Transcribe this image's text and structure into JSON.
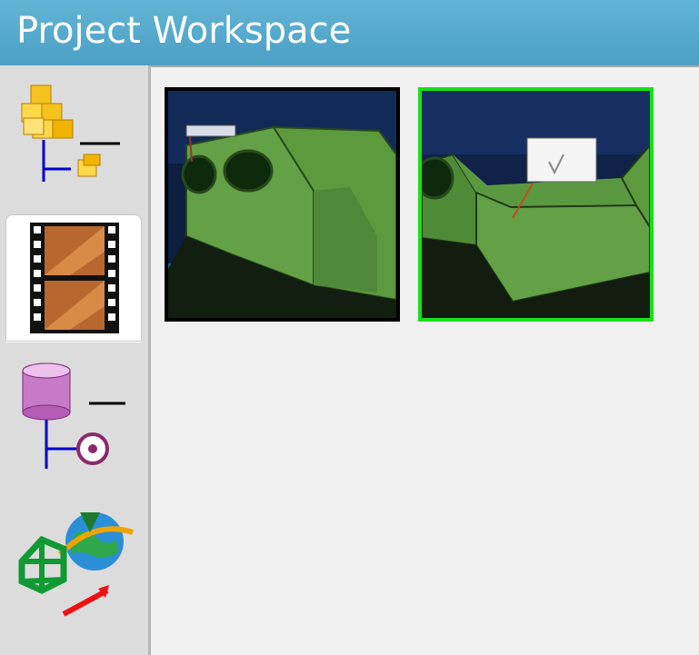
{
  "window": {
    "title": "Project Workspace"
  },
  "sidebar": {
    "items": [
      {
        "id": "product-structure",
        "icon": "product-structure-icon",
        "selected": false
      },
      {
        "id": "capture-viewer",
        "icon": "film-strip-icon",
        "selected": true
      },
      {
        "id": "database-tree",
        "icon": "database-tree-icon",
        "selected": false
      },
      {
        "id": "web-publish",
        "icon": "globe-publish-icon",
        "selected": false
      }
    ]
  },
  "content": {
    "thumbnails": [
      {
        "id": "capture-1",
        "selected": false,
        "border_color": "#000000"
      },
      {
        "id": "capture-2",
        "selected": true,
        "border_color": "#18e018"
      }
    ]
  },
  "colors": {
    "titlebar": "#55a9cc",
    "sidebar": "#dcdcdc",
    "content": "#f0f0f0",
    "selection": "#18e018"
  }
}
